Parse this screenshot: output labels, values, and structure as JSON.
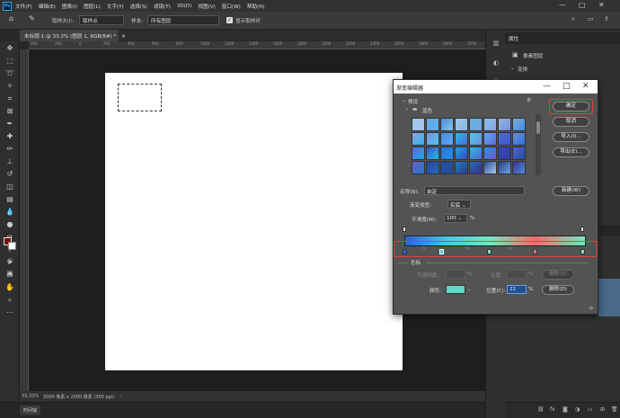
{
  "menubar": {
    "logo": "Ps",
    "items": [
      "文件(F)",
      "编辑(E)",
      "图像(I)",
      "图层(L)",
      "文字(Y)",
      "选择(S)",
      "滤镜(T)",
      "3D(D)",
      "视图(V)",
      "窗口(W)",
      "帮助(H)"
    ],
    "minimize": "—",
    "maximize": "□",
    "close": "✕"
  },
  "options": {
    "sample_size_label": "取样大小:",
    "sample_size_value": "取样点",
    "sample_label": "样本:",
    "sample_value": "所有图层",
    "show_ring_label": "显示取样环",
    "show_ring_checked": "✓"
  },
  "document": {
    "tab_title": "未标题-1 @ 33.3% (图层 1, RGB/8#) *",
    "tab_close": "✕",
    "ruler_numbers": [
      "400",
      "200",
      "0",
      "200",
      "400",
      "600",
      "800",
      "1000",
      "1200",
      "1400",
      "1600",
      "1800",
      "2000",
      "2200",
      "2400",
      "2600",
      "2800",
      "3000",
      "3200"
    ]
  },
  "status": {
    "zoom": "33.33%",
    "info": "2000 像素 x 2000 像素 (300 ppi)",
    "arrow": "›"
  },
  "timeline": {
    "label": "时间轴"
  },
  "right_panel": {
    "title": "属性",
    "item1": "像素图层",
    "item2": "变换"
  },
  "dialog": {
    "title": "渐变编辑器",
    "presets_label": "预设",
    "folder_label": "蓝色",
    "ok": "确定",
    "cancel": "取消",
    "import": "导入(I)...",
    "export": "导出(E)...",
    "name_label": "名称(N):",
    "name_value": "自定",
    "new_button": "新建(W)",
    "type_label": "渐变类型:",
    "type_value": "实底",
    "smooth_label": "平滑度(M):",
    "smooth_value": "100",
    "smooth_unit": "%",
    "stops_group": "色标",
    "opacity_label": "不透明度:",
    "opacity_unit": "%",
    "location_label": "位置:",
    "location_unit": "%",
    "delete_top": "删除(D)",
    "color_label": "颜色:",
    "location2_label": "位置(C):",
    "location2_value": "22",
    "location2_unit": "%",
    "delete_bottom": "删除(D)",
    "gear": "⚙",
    "minimize": "—",
    "maximize": "□",
    "close": "✕"
  },
  "colors": {
    "swatches": [
      "#a6c8ea",
      "#6aa4e0",
      "#4c8fdc",
      "#9fc6ee",
      "#5bb3ea",
      "#86c1e9",
      "#90b8dc",
      "#7da9d6",
      "#8fa0e6",
      "#7b8ddd",
      "#3f8fe6",
      "#2cb5ea",
      "#4ec8ef",
      "#63a8ee",
      "#4d6ed1",
      "#6f8fd6",
      "#5b6cd8",
      "#3b55c8",
      "#2474e0",
      "#19a8f0",
      "#1fc1e8",
      "#2a8fe3",
      "#3c47b8",
      "#5b5fcf",
      "#6e58c9",
      "#2d3f9c",
      "#1d4fa3",
      "#1e7fc5",
      "#1f6fb8",
      "#294c9c",
      "#283b85",
      "#3d2e8a"
    ],
    "gradient_stops": [
      "#2f5fd6",
      "#3ec7e6",
      "#74e6c8",
      "#f06b6b"
    ],
    "selected_color": "#5ed8c8",
    "accent_red": "#e0403a"
  }
}
